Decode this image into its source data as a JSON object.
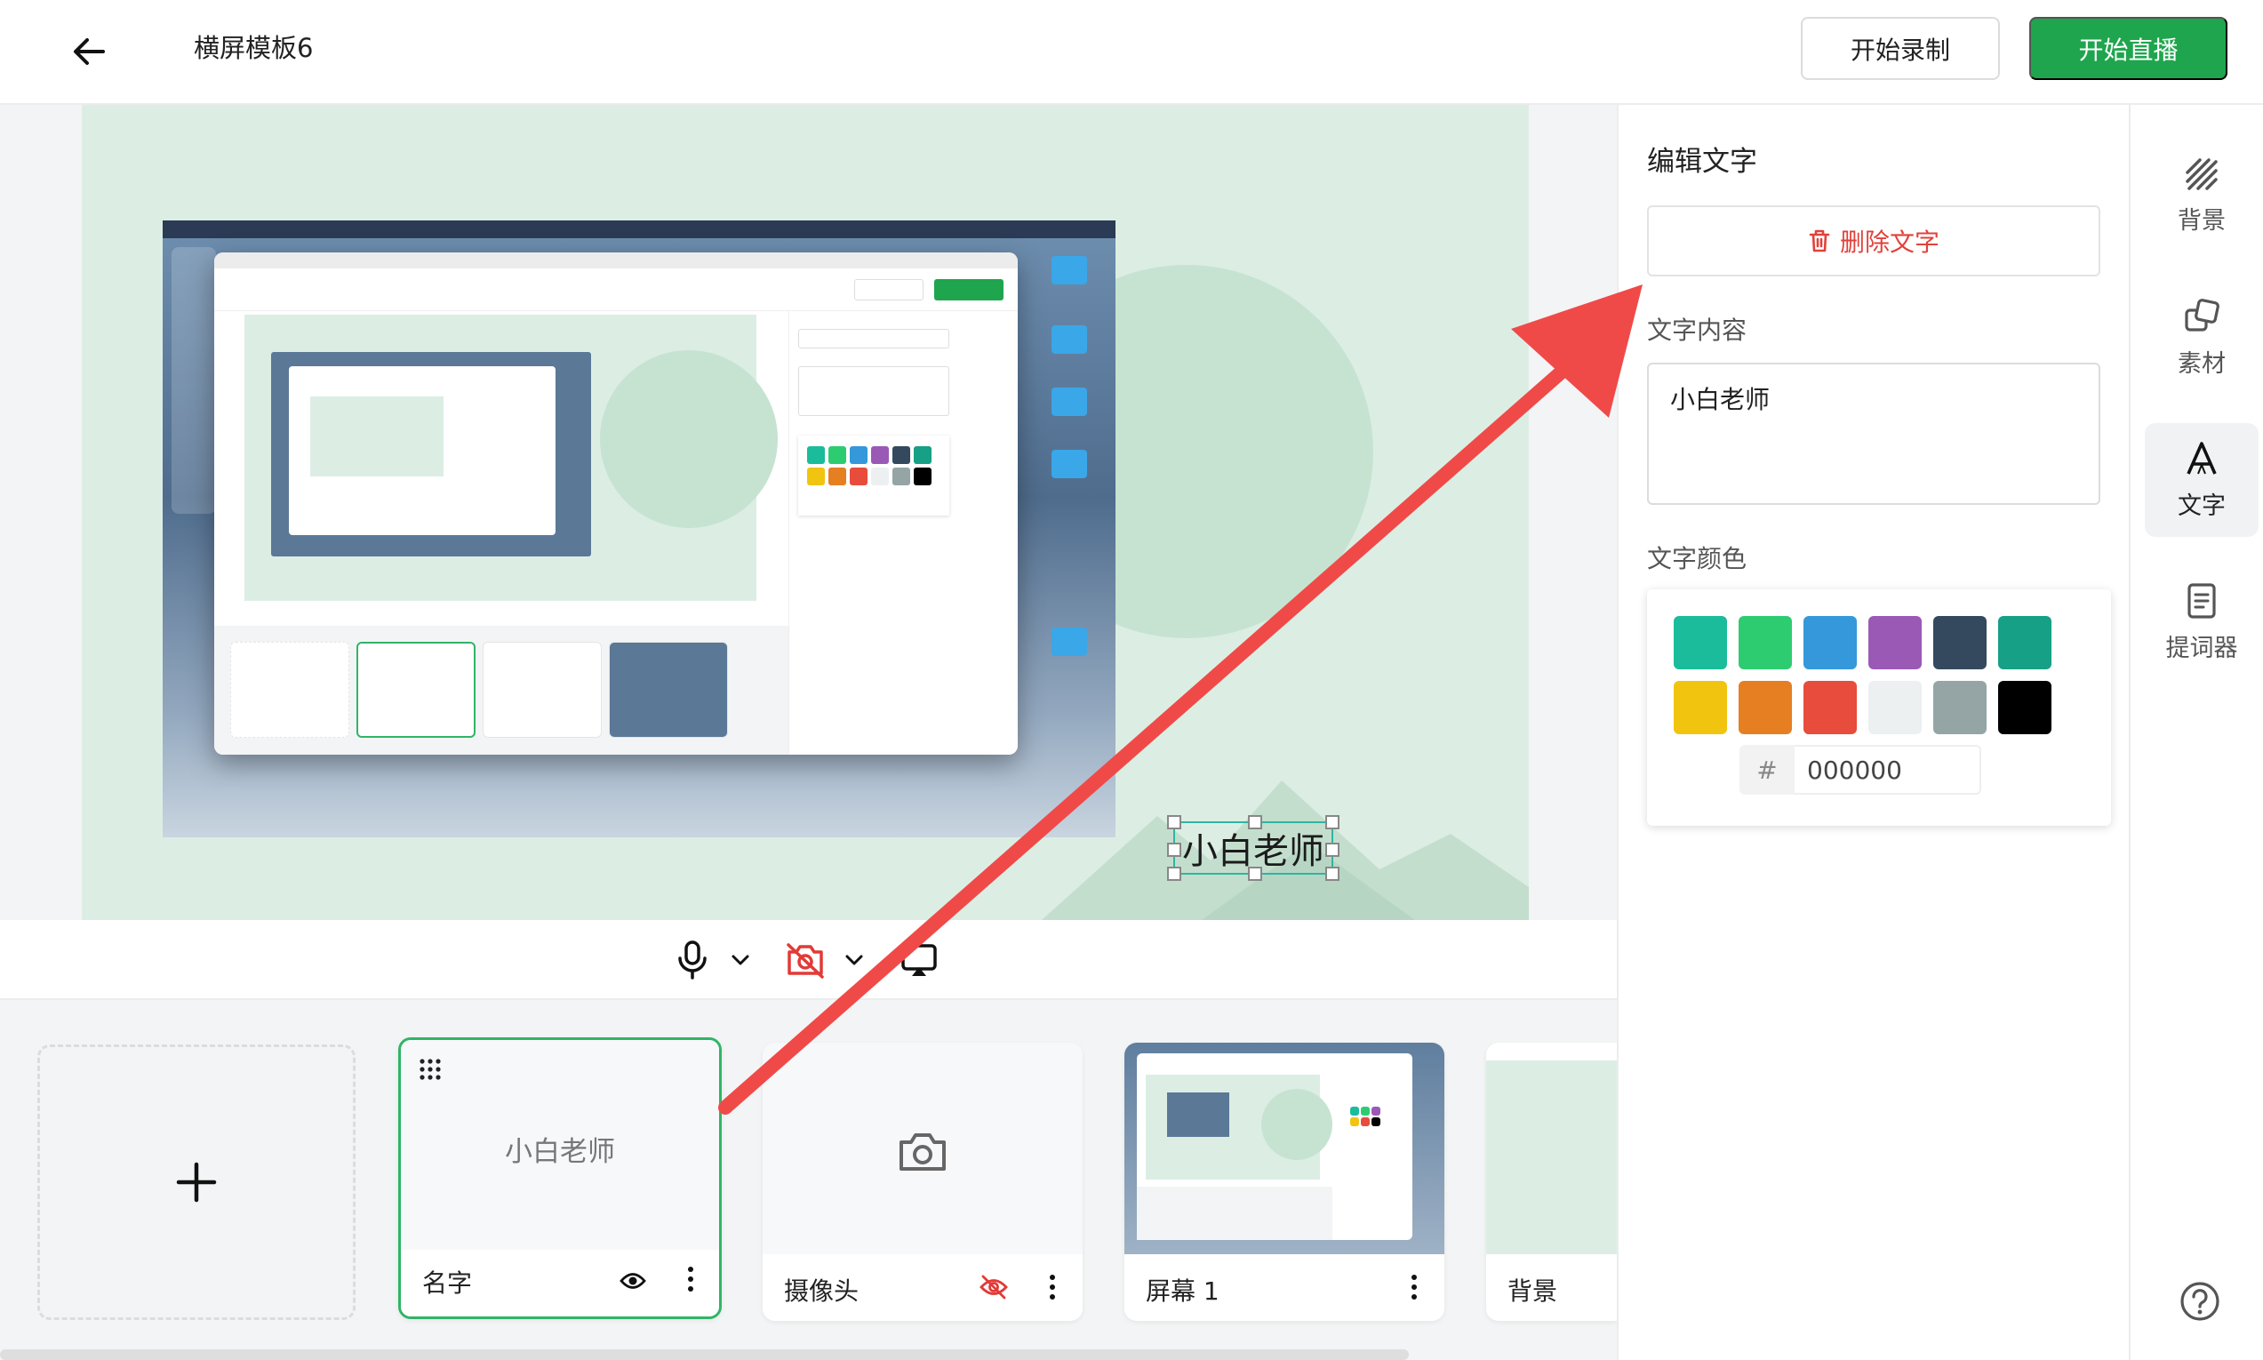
{
  "header": {
    "back_icon": "arrow-left-icon",
    "title": "横屏模板6",
    "record_label": "开始录制",
    "live_label": "开始直播",
    "accent_color": "#1fa54d"
  },
  "canvas": {
    "text": "小白老师",
    "background_color": "#dceee4"
  },
  "controls": {
    "mic_icon": "microphone-icon",
    "camera_icon": "camera-off-icon",
    "screen_icon": "screen-share-icon",
    "dropdown_icon": "chevron-down-icon"
  },
  "sources": {
    "add_icon": "plus-icon",
    "items": [
      {
        "label": "名字",
        "preview_text": "小白老师",
        "visible": true
      },
      {
        "label": "摄像头",
        "visible": false
      },
      {
        "label": "屏幕 1",
        "visible": true
      },
      {
        "label": "背景",
        "visible": true
      }
    ]
  },
  "panel": {
    "title": "编辑文字",
    "delete_label": "删除文字",
    "content_label": "文字内容",
    "content_value": "小白老师",
    "color_label": "文字颜色",
    "hex_prefix": "#",
    "hex_value": "000000",
    "swatches": [
      "#1abc9c",
      "#2ecc71",
      "#3498db",
      "#9b59b6",
      "#34495e",
      "#16a085",
      "#f1c40f",
      "#e67e22",
      "#e74c3c",
      "#ecf0f1",
      "#95a5a6",
      "#000000"
    ],
    "danger_color": "#e0423b"
  },
  "toolbar": {
    "items": [
      {
        "label": "背景",
        "icon": "background-icon"
      },
      {
        "label": "素材",
        "icon": "material-icon"
      },
      {
        "label": "文字",
        "icon": "text-icon"
      },
      {
        "label": "提词器",
        "icon": "teleprompter-icon"
      }
    ],
    "help_icon": "help-icon"
  },
  "annotation": {
    "color": "#f04a48"
  }
}
